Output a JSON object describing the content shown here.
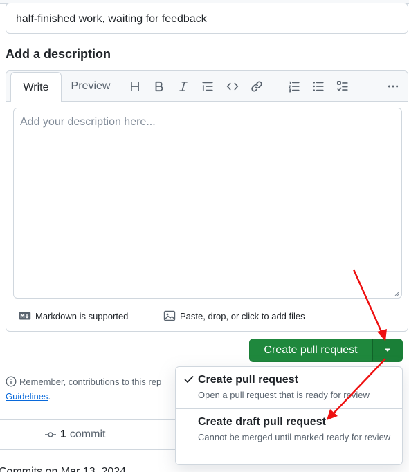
{
  "title_input": {
    "value": "half-finished work, waiting for feedback"
  },
  "description": {
    "label": "Add a description",
    "tabs": {
      "write": "Write",
      "preview": "Preview"
    },
    "toolbar_icons": [
      "heading-icon",
      "bold-icon",
      "italic-icon",
      "quote-icon",
      "code-icon",
      "link-icon",
      "ordered-list-icon",
      "unordered-list-icon",
      "task-list-icon",
      "more-options-icon"
    ],
    "placeholder": "Add your description here...",
    "footer": {
      "markdown": "Markdown is supported",
      "attach": "Paste, drop, or click to add files"
    }
  },
  "actions": {
    "create_label": "Create pull request"
  },
  "notice": {
    "prefix": "Remember, contributions to this rep",
    "link": "Guidelines",
    "suffix": "."
  },
  "commits": {
    "count": "1",
    "label": "commit",
    "date_header": "Commits on Mar 13, 2024"
  },
  "menu": {
    "items": [
      {
        "title": "Create pull request",
        "desc": "Open a pull request that is ready for review",
        "selected": true
      },
      {
        "title": "Create draft pull request",
        "desc": "Cannot be merged until marked ready for review",
        "selected": false
      }
    ]
  },
  "colors": {
    "primary_green": "#1f883d",
    "annotation_red": "#ee1111",
    "link_blue": "#0969da"
  }
}
